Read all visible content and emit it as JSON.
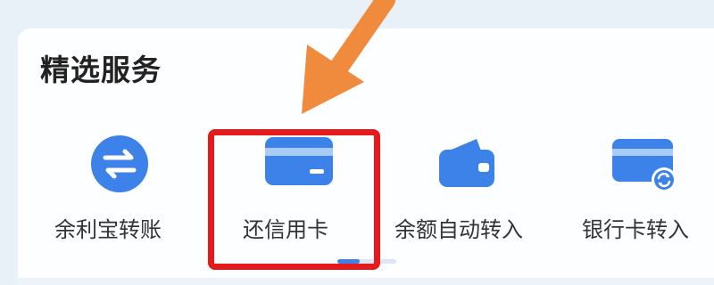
{
  "section": {
    "title": "精选服务"
  },
  "services": [
    {
      "label": "余利宝转账",
      "icon": "transfer-arrows-icon"
    },
    {
      "label": "还信用卡",
      "icon": "credit-card-icon"
    },
    {
      "label": "余额自动转入",
      "icon": "wallet-icon"
    },
    {
      "label": "银行卡转入",
      "icon": "bank-card-refresh-icon"
    }
  ],
  "pager": {
    "active_fraction": 0.38
  },
  "annotations": {
    "arrow_color": "#f08a3c",
    "highlight_color": "#e51a1a"
  },
  "colors": {
    "brand_blue": "#3d82e8",
    "background": "#e9f1f8",
    "card": "#fdfeff"
  }
}
